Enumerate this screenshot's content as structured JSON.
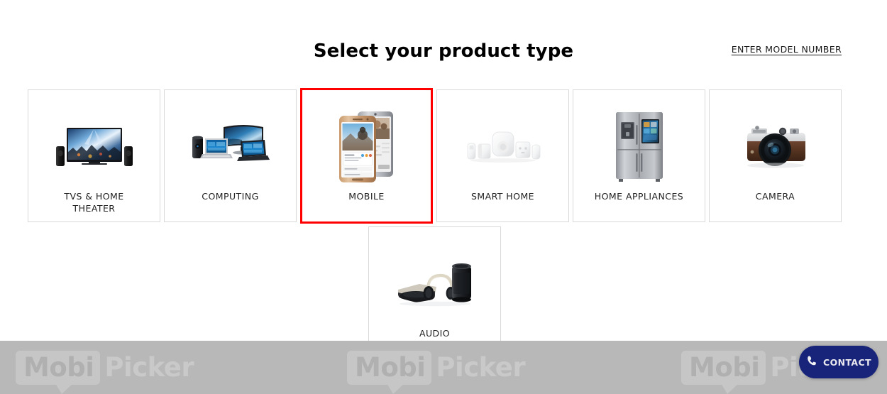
{
  "header": {
    "title": "Select your product type",
    "model_link": "ENTER MODEL NUMBER"
  },
  "colors": {
    "selected_border": "#ff0000",
    "card_border": "#d8d8d8",
    "page_background": "#ffffff",
    "watermark_bar": "#b8b8b8",
    "contact_button": "#17247a",
    "title_text": "#000000",
    "label_text": "#222222"
  },
  "product_grid": {
    "row_one": [
      {
        "label": "TVS & HOME THEATER",
        "label_lines": [
          "TVS & HOME",
          "THEATER"
        ],
        "icon": "tv-home-theater-icon",
        "selected": false
      },
      {
        "label": "COMPUTING",
        "label_lines": [
          "COMPUTING"
        ],
        "icon": "computing-icon",
        "selected": false
      },
      {
        "label": "MOBILE",
        "label_lines": [
          "MOBILE"
        ],
        "icon": "mobile-phone-icon",
        "selected": true
      },
      {
        "label": "SMART HOME",
        "label_lines": [
          "SMART HOME"
        ],
        "icon": "smart-home-icon",
        "selected": false
      },
      {
        "label": "HOME APPLIANCES",
        "label_lines": [
          "HOME APPLIANCES"
        ],
        "icon": "refrigerator-icon",
        "selected": false
      },
      {
        "label": "CAMERA",
        "label_lines": [
          "CAMERA"
        ],
        "icon": "camera-icon",
        "selected": false
      }
    ],
    "row_two": [
      {
        "label": "AUDIO",
        "label_lines": [
          "AUDIO"
        ],
        "icon": "audio-speaker-headphones-icon",
        "selected": false
      }
    ]
  },
  "watermarks": [
    {
      "boxed_text": "Mobi",
      "plain_text": "Picker"
    },
    {
      "boxed_text": "Mobi",
      "plain_text": "Picker"
    },
    {
      "boxed_text": "Mobi",
      "plain_text": "Picker"
    }
  ],
  "contact_button": {
    "label": "CONTACT",
    "icon": "phone-handset-icon"
  }
}
